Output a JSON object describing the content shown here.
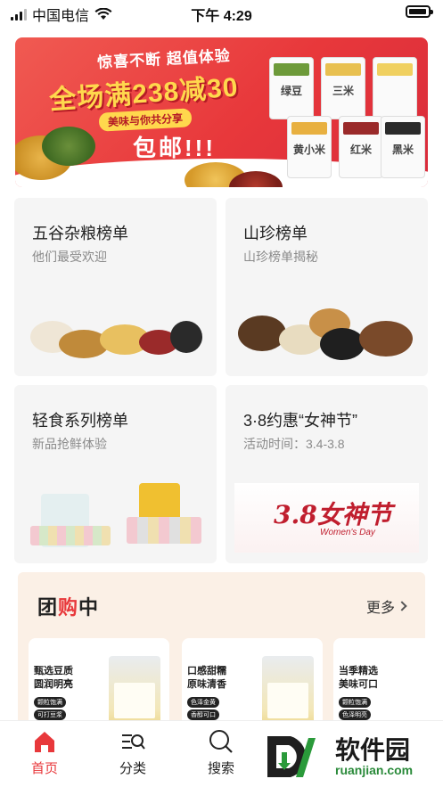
{
  "status_bar": {
    "carrier": "中国电信",
    "time": "下午 4:29"
  },
  "banner": {
    "subtitle": "惊喜不断 超值体验",
    "headline": "全场满238减30",
    "pill": "美味与你共分享",
    "free_shipping": "包邮!!!",
    "bags": [
      "绿豆",
      "三米",
      "黄小米",
      "红米",
      "黑米"
    ]
  },
  "cards": [
    {
      "title": "五谷杂粮榜单",
      "desc": "他们最受欢迎"
    },
    {
      "title": "山珍榜单",
      "desc": "山珍榜单揭秘"
    },
    {
      "title": "轻食系列榜单",
      "desc": "新品抢鲜体验"
    },
    {
      "title": "3·8约惠“女神节”",
      "desc": "活动时间：3.4-3.8",
      "art_text": "3.8女神节",
      "art_en": "Women's Day"
    }
  ],
  "group_buy": {
    "title_a": "团",
    "title_b": "购",
    "title_c": "中",
    "more": "更多",
    "products": [
      {
        "line1": "甄选豆质",
        "line2": "圆润明亮",
        "tags": [
          "颗粒饱满",
          "可打豆浆"
        ]
      },
      {
        "line1": "口感甜糯",
        "line2": "原味清香",
        "tags": [
          "色泽金黄",
          "香醇可口"
        ]
      },
      {
        "line1": "当季精选",
        "line2": "美味可口",
        "tags": [
          "颗粒饱满",
          "色泽明亮"
        ]
      }
    ]
  },
  "tabs": [
    {
      "label": "首页"
    },
    {
      "label": "分类"
    },
    {
      "label": "搜索"
    }
  ],
  "watermark": {
    "title": "软件园",
    "url": "ruanjian.com"
  },
  "colors": {
    "accent": "#e8383b",
    "banner_yellow": "#ffd84d"
  }
}
